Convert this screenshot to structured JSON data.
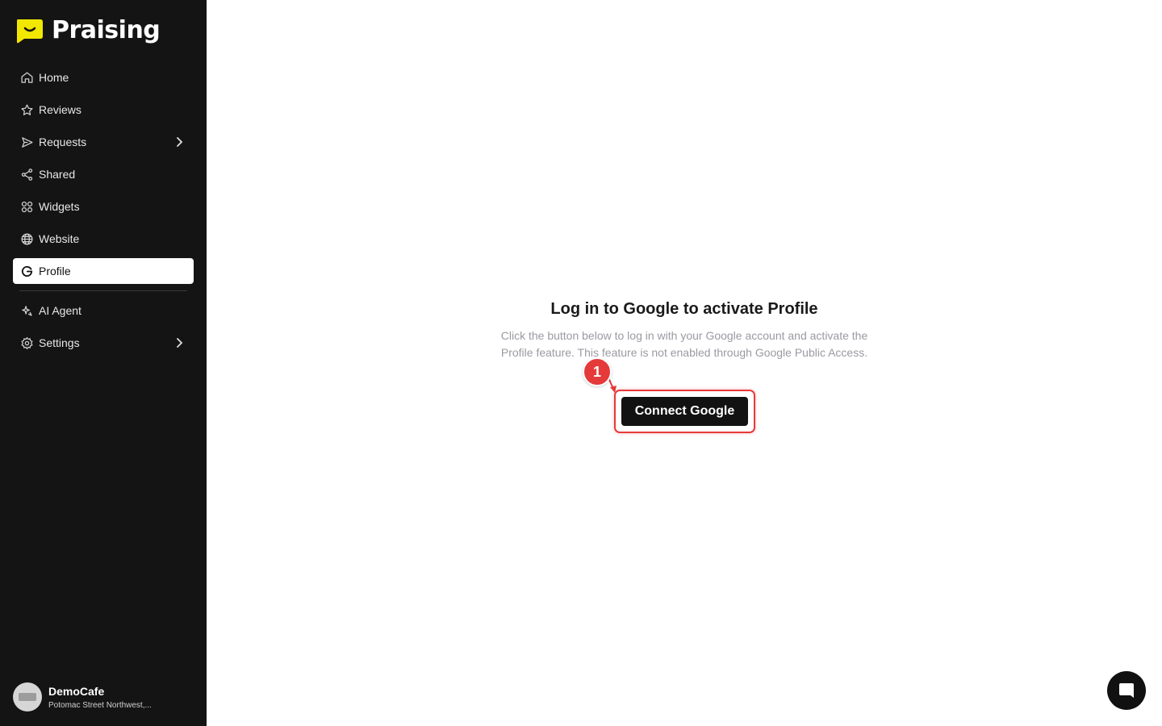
{
  "brand": {
    "name": "Praising",
    "accent": "#f2e700"
  },
  "sidebar": {
    "items": [
      {
        "label": "Home",
        "icon": "home-icon"
      },
      {
        "label": "Reviews",
        "icon": "star-icon"
      },
      {
        "label": "Requests",
        "icon": "send-icon",
        "has_submenu": true
      },
      {
        "label": "Shared",
        "icon": "share-icon"
      },
      {
        "label": "Widgets",
        "icon": "widgets-icon"
      },
      {
        "label": "Website",
        "icon": "globe-icon"
      },
      {
        "label": "Profile",
        "icon": "google-icon",
        "active": true
      },
      {
        "label": "AI Agent",
        "icon": "sparkle-icon"
      },
      {
        "label": "Settings",
        "icon": "gear-icon",
        "has_submenu": true
      }
    ],
    "account": {
      "name": "DemoCafe",
      "address": "Potomac Street Northwest,..."
    }
  },
  "main": {
    "title": "Log in to Google to activate Profile",
    "description": "Click the button below to log in with your Google account and activate the Profile feature. This feature is not enabled through Google Public Access.",
    "button_label": "Connect Google",
    "step_number": "1"
  },
  "colors": {
    "sidebar_bg": "#141414",
    "highlight": "#e63a3a",
    "button_bg": "#121212"
  }
}
